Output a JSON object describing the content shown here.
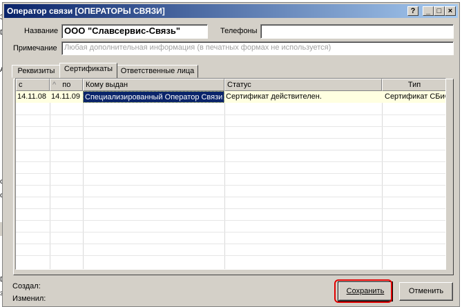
{
  "window": {
    "title": "Оператор связи [ОПЕРАТОРЫ СВЯЗИ]",
    "help_btn": "?",
    "min_btn": "_",
    "max_btn": "□",
    "close_btn": "×"
  },
  "form": {
    "name_label": "Название",
    "name_value": "ООО \"Славсервис-Связь\"",
    "phones_label": "Телефоны",
    "phones_value": "",
    "note_label": "Примечание",
    "note_placeholder": "Любая дополнительная информация (в печатных формах не используется)"
  },
  "tabs": [
    {
      "label": "Реквизиты",
      "active": false
    },
    {
      "label": "Сертификаты",
      "active": true
    },
    {
      "label": "Ответственные лица",
      "active": false
    }
  ],
  "table": {
    "columns": [
      "с",
      "по",
      "Кому выдан",
      "Статус",
      "Тип"
    ],
    "sort_marker": "^",
    "rows": [
      {
        "from": "14.11.08",
        "to": "14.11.09",
        "issued_to": "Специализированный Оператор Связи",
        "status": "Сертификат действителен.",
        "type": "Сертификат СБиС"
      }
    ]
  },
  "footer": {
    "created_label": "Создал:",
    "modified_label": "Изменил:",
    "save_label": "Сохранить",
    "cancel_label": "Отменить"
  },
  "background": {
    "frag1": "З",
    "frag2": "D",
    "frag3": "А",
    "frag4": "с",
    "frag5": "с",
    "frag6": "D",
    "frag7": "з"
  },
  "colors": {
    "title_start": "#0a246a",
    "title_end": "#a6caf0",
    "selected_row": "#ffffe1",
    "selected_cell": "#0a246a",
    "annotation": "#e00000"
  }
}
